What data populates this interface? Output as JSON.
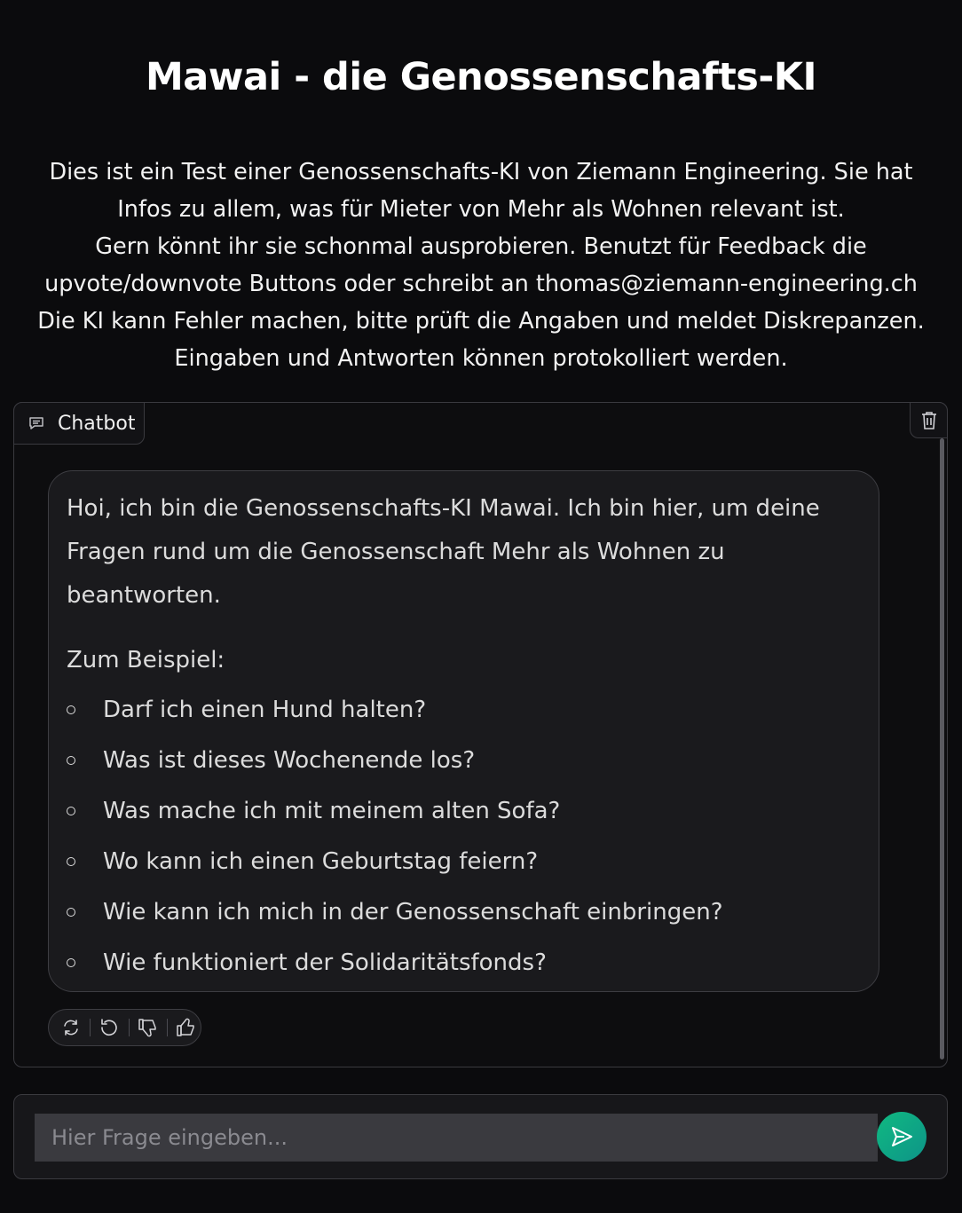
{
  "header": {
    "title": "Mawai - die Genossenschafts-KI"
  },
  "intro": {
    "lines": [
      "Dies ist ein Test einer Genossenschafts-KI von Ziemann Engineering. Sie hat",
      "Infos zu allem, was für Mieter von Mehr als Wohnen relevant ist.",
      "Gern könnt ihr sie schonmal ausprobieren. Benutzt für Feedback die",
      "upvote/downvote Buttons oder schreibt an thomas@ziemann-engineering.ch",
      "Die KI kann Fehler machen, bitte prüft die Angaben und meldet Diskrepanzen.",
      "Eingaben und Antworten können protokolliert werden."
    ]
  },
  "chatbot": {
    "tab_label": "Chatbot",
    "tab_icon": "chat-icon",
    "clear_icon": "trash-icon",
    "message": {
      "greeting": "Hoi, ich bin die Genossenschafts-KI Mawai. Ich bin hier, um deine Fragen rund um die Genossenschaft Mehr als Wohnen zu beantworten.",
      "examples_heading": "Zum Beispiel:",
      "examples": [
        "Darf ich einen Hund halten?",
        "Was ist dieses Wochenende los?",
        "Was mache ich mit meinem alten Sofa?",
        "Wo kann ich einen Geburtstag feiern?",
        "Wie kann ich mich in der Genossenschaft einbringen?",
        "Wie funktioniert der Solidaritätsfonds?"
      ]
    },
    "actions": [
      "retry-icon",
      "undo-icon",
      "thumbs-down-icon",
      "thumbs-up-icon"
    ]
  },
  "input": {
    "placeholder": "Hier Frage eingeben...",
    "value": "",
    "send_icon": "send-icon",
    "send_color": "#10b981"
  }
}
